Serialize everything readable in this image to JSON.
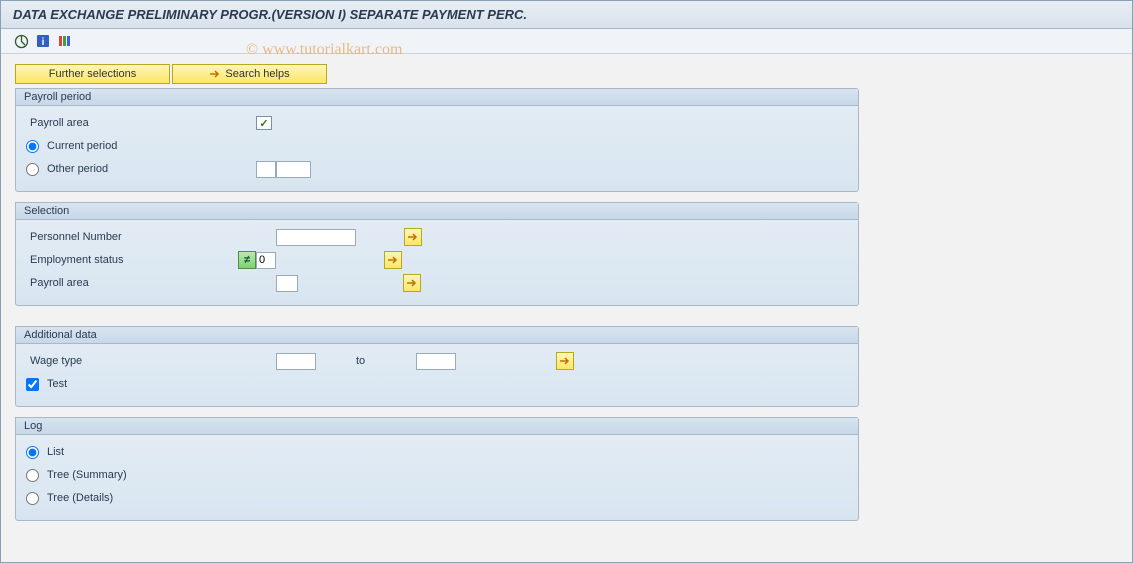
{
  "title": "DATA EXCHANGE PRELIMINARY PROGR.(VERSION I) SEPARATE PAYMENT PERC.",
  "watermark": "© www.tutorialkart.com",
  "buttons": {
    "further_selections": "Further selections",
    "search_helps": "Search helps"
  },
  "groups": {
    "payroll_period": {
      "title": "Payroll period",
      "payroll_area_label": "Payroll area",
      "current_period": "Current period",
      "other_period": "Other period"
    },
    "selection": {
      "title": "Selection",
      "personnel_number": "Personnel Number",
      "employment_status": "Employment status",
      "employment_status_value": "0",
      "payroll_area": "Payroll area"
    },
    "additional_data": {
      "title": "Additional data",
      "wage_type": "Wage type",
      "to": "to",
      "test": "Test"
    },
    "log": {
      "title": "Log",
      "list": "List",
      "tree_summary": "Tree (Summary)",
      "tree_details": "Tree (Details)"
    }
  }
}
